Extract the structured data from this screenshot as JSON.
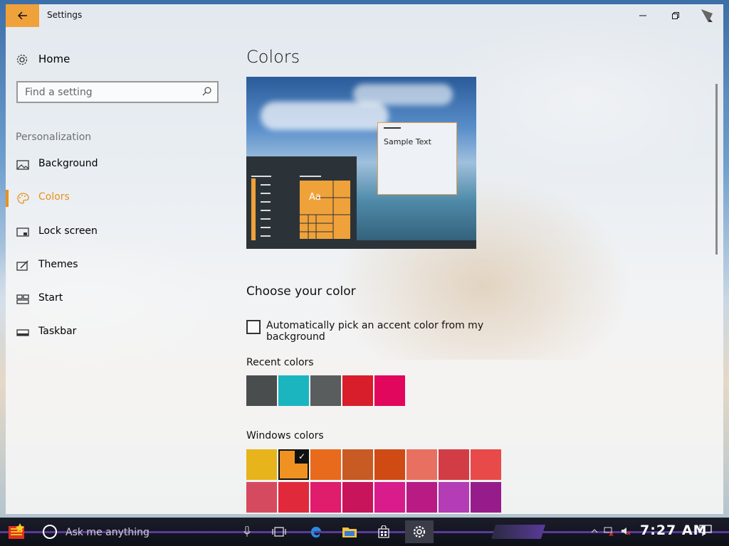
{
  "window": {
    "title": "Settings"
  },
  "sidebar": {
    "home_label": "Home",
    "search_placeholder": "Find a setting",
    "section_header": "Personalization",
    "items": [
      {
        "label": "Background",
        "icon": "picture-icon",
        "active": false
      },
      {
        "label": "Colors",
        "icon": "palette-icon",
        "active": true
      },
      {
        "label": "Lock screen",
        "icon": "monitor-icon",
        "active": false
      },
      {
        "label": "Themes",
        "icon": "brush-icon",
        "active": false
      },
      {
        "label": "Start",
        "icon": "start-tiles-icon",
        "active": false
      },
      {
        "label": "Taskbar",
        "icon": "taskbar-icon",
        "active": false
      }
    ]
  },
  "main": {
    "title": "Colors",
    "preview": {
      "tile_text": "Aa",
      "sample_text": "Sample Text"
    },
    "choose_heading": "Choose your color",
    "auto_accent_label": "Automatically pick an accent color from my background",
    "auto_accent_checked": false,
    "recent_colors_label": "Recent colors",
    "recent_colors": [
      "#4a4d4e",
      "#1bb5c0",
      "#5a5d5d",
      "#d81e2a",
      "#e0075c"
    ],
    "windows_colors_label": "Windows colors",
    "windows_colors": [
      "#e8b41c",
      "#f09222",
      "#e86a1c",
      "#c85a24",
      "#d04a14",
      "#e87060",
      "#d23c44",
      "#e84a4a",
      "#d64a60",
      "#e02a3c",
      "#e01c6c",
      "#c8145a",
      "#d81c8c",
      "#b81c84",
      "#b43cb4",
      "#961c8c"
    ],
    "selected_color_index": 1
  },
  "taskbar": {
    "search_placeholder": "Ask me anything",
    "clock": "7:27 AM"
  },
  "colors": {
    "accent": "#f0a23a"
  }
}
